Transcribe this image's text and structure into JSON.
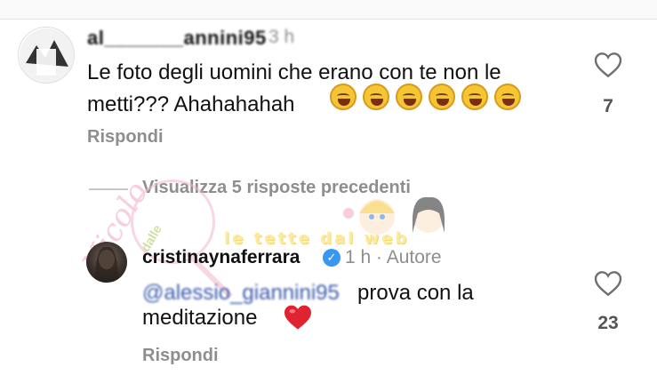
{
  "comment1": {
    "username": "al_______annini95",
    "time": "3 h",
    "text": "Le foto degli uomini che erano con te non le metti??? Ahahahahah",
    "emoji_count": 6,
    "emoji_name": "face-with-tears-of-joy",
    "likes": "7",
    "reply_label": "Rispondi"
  },
  "view_replies_label": "Visualizza 5 risposte precedenti",
  "comment2": {
    "username": "cristinaynaferrara",
    "verified": true,
    "meta": "1 h · Autore",
    "mention": "@alessio_giannini95",
    "text": "prova con la",
    "text_line2": "meditazione",
    "emoji_name": "red-heart",
    "likes": "23",
    "reply_label": "Rispondi"
  },
  "watermark": {
    "script_text": "Nicolo",
    "small_text": "dalle",
    "banner_text": "le tette dal web"
  },
  "colors": {
    "secondary_text": "#8e8e8e",
    "mention": "#3b5bab",
    "verified": "#3897f0",
    "watermark_pink": "#f4a6c4"
  }
}
